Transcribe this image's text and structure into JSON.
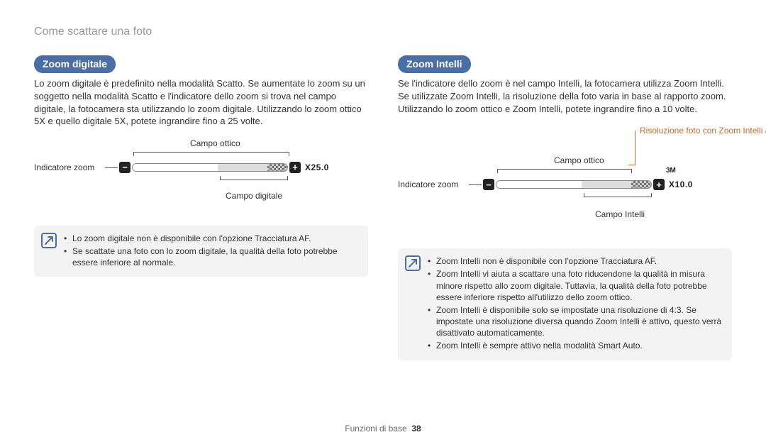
{
  "page": {
    "header": "Come scattare una foto",
    "footer_label": "Funzioni di base",
    "footer_page": "38"
  },
  "left": {
    "title": "Zoom digitale",
    "para": "Lo zoom digitale è predefinito nella modalità Scatto. Se aumentate lo zoom su un soggetto nella modalità Scatto e l'indicatore dello zoom si trova nel campo digitale, la fotocamera sta utilizzando lo zoom digitale. Utilizzando lo zoom ottico 5X e quello digitale 5X, potete ingrandire fino a 25 volte.",
    "labels": {
      "campo_ottico": "Campo ottico",
      "indicatore_zoom": "Indicatore zoom",
      "campo_digitale": "Campo digitale",
      "xval": "X25.0"
    },
    "notes": [
      "Lo zoom digitale non è disponibile con l'opzione Tracciatura AF.",
      "Se scattate una foto con lo zoom digitale, la qualità della foto potrebbe essere inferiore al normale."
    ]
  },
  "right": {
    "title": "Zoom Intelli",
    "para": "Se l'indicatore dello zoom è nel campo Intelli, la fotocamera utilizza Zoom Intelli. Se utilizzate Zoom Intelli, la risoluzione della foto varia in base al rapporto zoom. Utilizzando lo zoom ottico e Zoom Intelli, potete ingrandire fino a 10 volte.",
    "labels": {
      "campo_ottico": "Campo ottico",
      "indicatore_zoom": "Indicatore zoom",
      "campo_intelli": "Campo Intelli",
      "risoluzione": "Risoluzione foto con Zoom Intelli attivato",
      "mres": "3M",
      "xval": "X10.0"
    },
    "notes": [
      "Zoom Intelli non è disponibile con l'opzione Tracciatura AF.",
      "Zoom Intelli vi aiuta a scattare una foto riducendone la qualità in misura minore rispetto allo zoom digitale. Tuttavia, la qualità della foto potrebbe essere inferiore rispetto all'utilizzo dello zoom ottico.",
      "Zoom Intelli è disponibile solo se impostate una risoluzione di 4:3. Se impostate una risoluzione diversa quando Zoom Intelli è attivo, questo verrà disattivato automaticamente.",
      "Zoom Intelli è sempre attivo nella modalità Smart Auto."
    ]
  }
}
